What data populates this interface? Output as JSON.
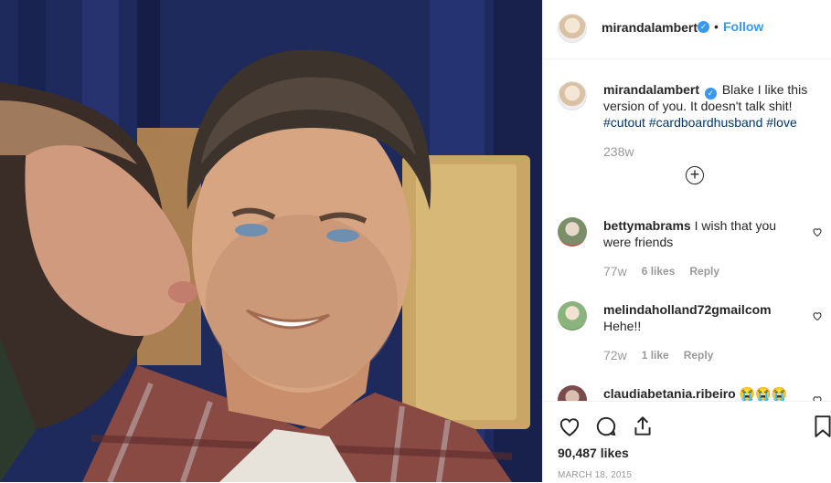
{
  "post": {
    "username": "mirandalambert",
    "verified_icon": "verified-badge-icon",
    "separator": "•",
    "follow_label": "Follow"
  },
  "caption": {
    "username": "mirandalambert",
    "text": "Blake I like this version of you. It doesn't talk shit!",
    "hashtags": [
      "#cutout",
      "#cardboardhusband",
      "#love"
    ],
    "age": "238w",
    "load_more_icon": "plus-circle-icon"
  },
  "comments": [
    {
      "username": "bettymabrams",
      "text": "I wish that you were friends",
      "age": "77w",
      "likes": "6 likes",
      "reply": "Reply"
    },
    {
      "username": "melindaholland72gmailcom",
      "text": "Hehe!!",
      "age": "72w",
      "likes": "1 like",
      "reply": "Reply"
    },
    {
      "username": "claudiabetania.ribeiro",
      "text": "😭😭😭",
      "age": "",
      "likes": "",
      "reply": ""
    }
  ],
  "actions": {
    "icons": [
      "heart-icon",
      "comment-icon",
      "share-icon",
      "bookmark-icon"
    ],
    "likes": "90,487 likes",
    "date": "MARCH 18, 2015"
  },
  "colors": {
    "accent": "#3897f0",
    "hashtag": "#003569",
    "muted": "#999999",
    "text": "#262626"
  }
}
